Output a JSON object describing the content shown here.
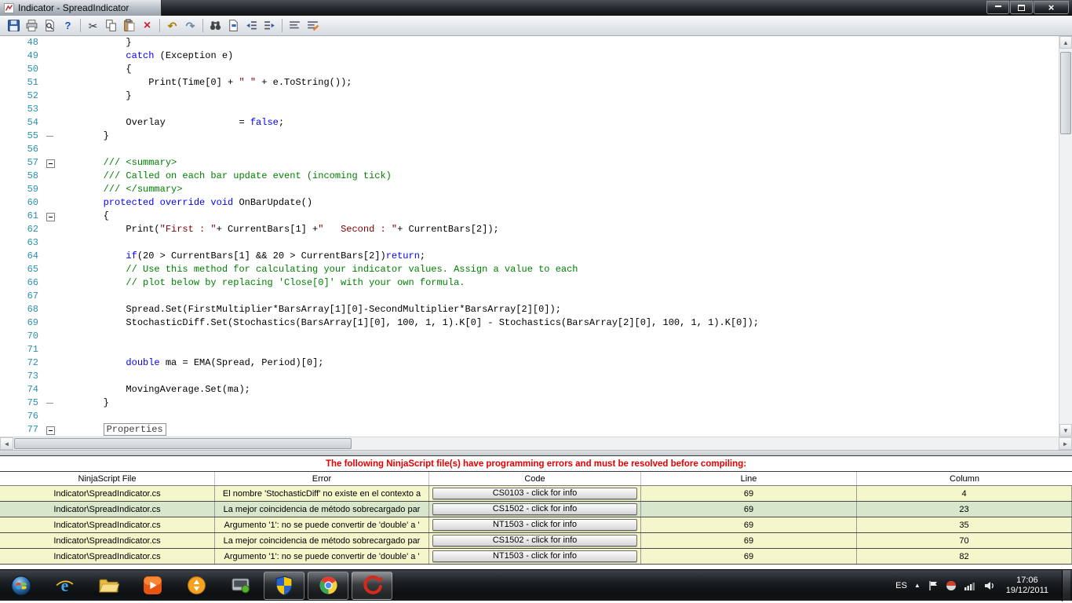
{
  "window": {
    "title": "Indicator - SpreadIndicator"
  },
  "toolbar": {
    "icons": [
      "save-icon",
      "print-icon",
      "print-preview-icon",
      "help-icon",
      "cut-icon",
      "copy-icon",
      "paste-icon",
      "delete-icon",
      "undo-icon",
      "redo-icon",
      "find-icon",
      "goto-icon",
      "outdent-icon",
      "indent-icon",
      "comment-icon",
      "uncomment-icon"
    ]
  },
  "editor": {
    "colors": {
      "keyword": "#0000ff",
      "comment": "#008000",
      "string": "#800000",
      "line_number": "#2b91af"
    },
    "lines": [
      {
        "n": 48,
        "f": "",
        "s": [
          {
            "t": "p",
            "x": "            }"
          }
        ]
      },
      {
        "n": 49,
        "f": "",
        "s": [
          {
            "t": "p",
            "x": "            "
          },
          {
            "t": "k",
            "x": "catch"
          },
          {
            "t": "p",
            "x": " (Exception e)"
          }
        ]
      },
      {
        "n": 50,
        "f": "",
        "s": [
          {
            "t": "p",
            "x": "            {"
          }
        ]
      },
      {
        "n": 51,
        "f": "",
        "s": [
          {
            "t": "p",
            "x": "                Print(Time[0] + "
          },
          {
            "t": "s",
            "x": "\" \""
          },
          {
            "t": "p",
            "x": " + e.ToString());"
          }
        ]
      },
      {
        "n": 52,
        "f": "",
        "s": [
          {
            "t": "p",
            "x": "            }"
          }
        ]
      },
      {
        "n": 53,
        "f": "",
        "s": []
      },
      {
        "n": 54,
        "f": "",
        "s": [
          {
            "t": "p",
            "x": "            Overlay             = "
          },
          {
            "t": "k",
            "x": "false"
          },
          {
            "t": "p",
            "x": ";"
          }
        ]
      },
      {
        "n": 55,
        "f": "tick",
        "s": [
          {
            "t": "p",
            "x": "        }"
          }
        ]
      },
      {
        "n": 56,
        "f": "",
        "s": []
      },
      {
        "n": 57,
        "f": "minus",
        "s": [
          {
            "t": "c",
            "x": "        /// <summary>"
          }
        ]
      },
      {
        "n": 58,
        "f": "",
        "s": [
          {
            "t": "c",
            "x": "        /// Called on each bar update event (incoming tick)"
          }
        ]
      },
      {
        "n": 59,
        "f": "",
        "s": [
          {
            "t": "c",
            "x": "        /// </summary>"
          }
        ]
      },
      {
        "n": 60,
        "f": "",
        "s": [
          {
            "t": "p",
            "x": "        "
          },
          {
            "t": "k",
            "x": "protected override void"
          },
          {
            "t": "p",
            "x": " OnBarUpdate()"
          }
        ]
      },
      {
        "n": 61,
        "f": "minus",
        "s": [
          {
            "t": "p",
            "x": "        {"
          }
        ]
      },
      {
        "n": 62,
        "f": "",
        "s": [
          {
            "t": "p",
            "x": "            Print("
          },
          {
            "t": "s",
            "x": "\"First : \""
          },
          {
            "t": "p",
            "x": "+ CurrentBars[1] +"
          },
          {
            "t": "s",
            "x": "\"   Second : \""
          },
          {
            "t": "p",
            "x": "+ CurrentBars[2]);"
          }
        ]
      },
      {
        "n": 63,
        "f": "",
        "s": []
      },
      {
        "n": 64,
        "f": "",
        "s": [
          {
            "t": "p",
            "x": "            "
          },
          {
            "t": "k",
            "x": "if"
          },
          {
            "t": "p",
            "x": "(20 > CurrentBars[1] && 20 > CurrentBars[2])"
          },
          {
            "t": "k",
            "x": "return"
          },
          {
            "t": "p",
            "x": ";"
          }
        ]
      },
      {
        "n": 65,
        "f": "",
        "s": [
          {
            "t": "c",
            "x": "            // Use this method for calculating your indicator values. Assign a value to each"
          }
        ]
      },
      {
        "n": 66,
        "f": "",
        "s": [
          {
            "t": "c",
            "x": "            // plot below by replacing 'Close[0]' with your own formula."
          }
        ]
      },
      {
        "n": 67,
        "f": "",
        "s": []
      },
      {
        "n": 68,
        "f": "",
        "s": [
          {
            "t": "p",
            "x": "            Spread.Set(FirstMultiplier*BarsArray[1][0]-SecondMultiplier*BarsArray[2][0]);"
          }
        ]
      },
      {
        "n": 69,
        "f": "",
        "s": [
          {
            "t": "p",
            "x": "            StochasticDiff.Set(Stochastics(BarsArray[1][0], 100, 1, 1).K[0] - Stochastics(BarsArray[2][0], 100, 1, 1).K[0]);"
          }
        ]
      },
      {
        "n": 70,
        "f": "",
        "s": []
      },
      {
        "n": 71,
        "f": "",
        "s": []
      },
      {
        "n": 72,
        "f": "",
        "s": [
          {
            "t": "p",
            "x": "            "
          },
          {
            "t": "k",
            "x": "double"
          },
          {
            "t": "p",
            "x": " ma = EMA(Spread, Period)[0];"
          }
        ]
      },
      {
        "n": 73,
        "f": "",
        "s": []
      },
      {
        "n": 74,
        "f": "",
        "s": [
          {
            "t": "p",
            "x": "            MovingAverage.Set(ma);"
          }
        ]
      },
      {
        "n": 75,
        "f": "tick",
        "s": [
          {
            "t": "p",
            "x": "        }"
          }
        ]
      },
      {
        "n": 76,
        "f": "",
        "s": []
      },
      {
        "n": 77,
        "f": "minus",
        "s": [
          {
            "t": "p",
            "x": "        "
          },
          {
            "t": "b",
            "x": "Properties"
          }
        ]
      }
    ]
  },
  "error_panel": {
    "banner": "The following NinjaScript file(s) have programming errors and must be resolved before compiling:",
    "columns": [
      "NinjaScript File",
      "Error",
      "Code",
      "Line",
      "Column"
    ],
    "row_colors": {
      "yellow": "#f6f6cc",
      "green": "#d8e6cc"
    },
    "rows": [
      {
        "file": "Indicator\\SpreadIndicator.cs",
        "error": "El nombre 'StochasticDiff' no existe en el contexto a",
        "code": "CS0103 - click for info",
        "line": "69",
        "column": "4",
        "bg": "#f6f6cc"
      },
      {
        "file": "Indicator\\SpreadIndicator.cs",
        "error": "La mejor coincidencia de método sobrecargado par",
        "code": "CS1502 - click for info",
        "line": "69",
        "column": "23",
        "bg": "#d8e6cc"
      },
      {
        "file": "Indicator\\SpreadIndicator.cs",
        "error": "Argumento '1': no se puede convertir de 'double' a '",
        "code": "NT1503 - click for info",
        "line": "69",
        "column": "35",
        "bg": "#f6f6cc"
      },
      {
        "file": "Indicator\\SpreadIndicator.cs",
        "error": "La mejor coincidencia de método sobrecargado par",
        "code": "CS1502 - click for info",
        "line": "69",
        "column": "70",
        "bg": "#f6f6cc"
      },
      {
        "file": "Indicator\\SpreadIndicator.cs",
        "error": "Argumento '1': no se puede convertir de 'double' a '",
        "code": "NT1503 - click for info",
        "line": "69",
        "column": "82",
        "bg": "#f6f6cc"
      }
    ]
  },
  "taskbar": {
    "icons": [
      "start-button",
      "internet-explorer-icon",
      "windows-explorer-icon",
      "media-player-icon",
      "download-manager-icon",
      "utility-app-icon",
      "ninjatrader-shield-icon",
      "chrome-icon",
      "ninjatrader-icon"
    ],
    "tray": {
      "language": "ES",
      "time": "17:06",
      "date": "19/12/2011"
    }
  }
}
